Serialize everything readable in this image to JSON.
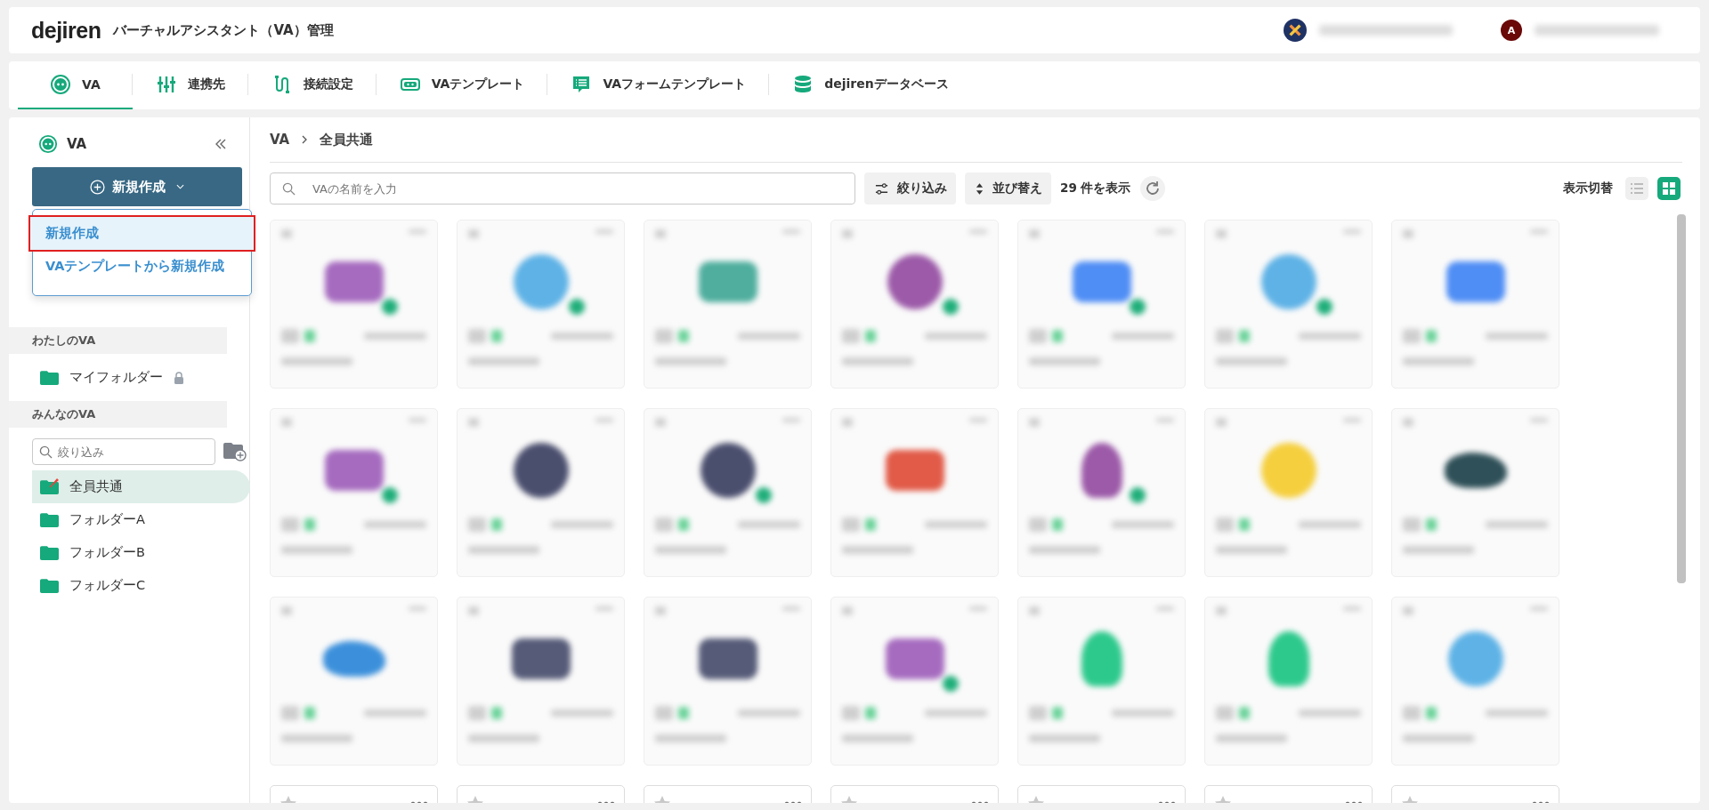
{
  "header": {
    "logo": "dejiren",
    "title": "バーチャルアシスタント（VA）管理",
    "user_initial": "A"
  },
  "tabs": [
    {
      "label": "VA",
      "selected": true
    },
    {
      "label": "連携先",
      "selected": false
    },
    {
      "label": "接続設定",
      "selected": false
    },
    {
      "label": "VAテンプレート",
      "selected": false
    },
    {
      "label": "VAフォームテンプレート",
      "selected": false
    },
    {
      "label": "dejirenデータベース",
      "selected": false
    }
  ],
  "sidebar": {
    "title": "VA",
    "create_button": "新規作成",
    "create_menu": [
      {
        "label": "新規作成",
        "selected": true
      },
      {
        "label": "VAテンプレートから新規作成",
        "selected": false
      }
    ],
    "my_section": "わたしのVA",
    "my_folders": [
      {
        "label": "マイフォルダー",
        "locked": true
      }
    ],
    "shared_section": "みんなのVA",
    "filter": {
      "placeholder": "絞り込み"
    },
    "folders": [
      {
        "label": "全員共通",
        "pinned": true,
        "selected": true
      },
      {
        "label": "フォルダーA",
        "pinned": false,
        "selected": false
      },
      {
        "label": "フォルダーB",
        "pinned": false,
        "selected": false
      },
      {
        "label": "フォルダーC",
        "pinned": false,
        "selected": false
      }
    ]
  },
  "breadcrumb": [
    "VA",
    "全員共通"
  ],
  "toolbar": {
    "search": {
      "placeholder": "VAの名前を入力"
    },
    "filter_button": "絞り込み",
    "sort_button": "並び替え",
    "count": "29 件を表示",
    "view_label": "表示切替",
    "views": [
      {
        "kind": "list",
        "selected": false
      },
      {
        "kind": "grid",
        "selected": true
      }
    ]
  },
  "cards": [
    {
      "kind": "square",
      "color": "#a66bbf",
      "badge": true
    },
    {
      "kind": "circle",
      "color": "#5eb2e6",
      "badge": true
    },
    {
      "kind": "square",
      "color": "#4fae9e",
      "badge": false
    },
    {
      "kind": "circle",
      "color": "#9c5aa8",
      "badge": true
    },
    {
      "kind": "square",
      "color": "#4f8ef5",
      "badge": true
    },
    {
      "kind": "circle",
      "color": "#5eb2e6",
      "badge": true
    },
    {
      "kind": "square",
      "color": "#4f8ef5",
      "badge": false
    },
    {
      "kind": "square",
      "color": "#a66bbf",
      "badge": true
    },
    {
      "kind": "circle",
      "color": "#4b4f6e",
      "badge": false
    },
    {
      "kind": "circle",
      "color": "#4b4f6e",
      "badge": true
    },
    {
      "kind": "square",
      "color": "#e15b48",
      "badge": false
    },
    {
      "kind": "robot",
      "color": "#9c5aa8",
      "badge": true
    },
    {
      "kind": "circle",
      "color": "#f5cf3e",
      "badge": false
    },
    {
      "kind": "whale",
      "color": "#2f5058",
      "badge": false
    },
    {
      "kind": "whale",
      "color": "#3c90db",
      "badge": false
    },
    {
      "kind": "square",
      "color": "#565b78",
      "badge": false
    },
    {
      "kind": "square",
      "color": "#565b78",
      "badge": false
    },
    {
      "kind": "square",
      "color": "#a66bbf",
      "badge": true
    },
    {
      "kind": "robot",
      "color": "#2dc98c",
      "badge": false
    },
    {
      "kind": "robot",
      "color": "#2dc98c",
      "badge": false
    },
    {
      "kind": "circle",
      "color": "#5eb2e6",
      "badge": false
    }
  ]
}
